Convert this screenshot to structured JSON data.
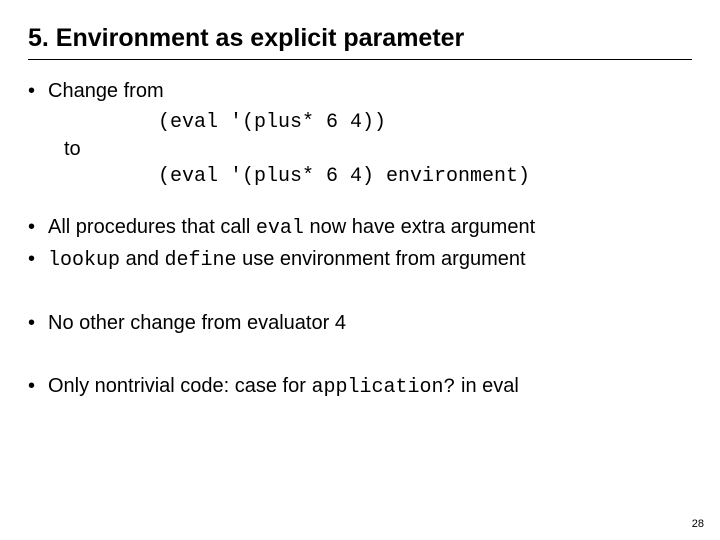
{
  "title": "5. Environment as explicit parameter",
  "bullets": {
    "b1": "Change from",
    "code1": "(eval '(plus* 6 4))",
    "to": "to",
    "code2": "(eval '(plus* 6 4) environment)",
    "b2_pre": "All procedures that call ",
    "b2_code": "eval",
    "b2_post": " now have extra argument",
    "b3_code1": "lookup",
    "b3_mid": " and ",
    "b3_code2": "define",
    "b3_post": " use environment from argument",
    "b4": "No other change from evaluator 4",
    "b5_pre": "Only nontrivial code: case for ",
    "b5_code": "application?",
    "b5_post": " in eval"
  },
  "page": "28"
}
